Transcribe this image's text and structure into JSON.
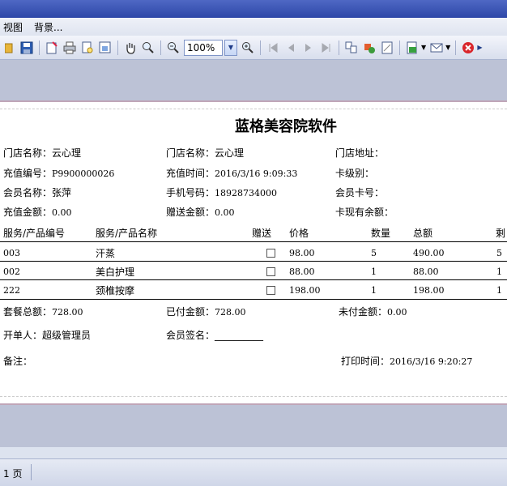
{
  "menu": {
    "view": "视图",
    "background": "背景..."
  },
  "toolbar": {
    "zoom_value": "100%"
  },
  "report": {
    "title": "蓝格美容院软件",
    "fields": {
      "store_name_1": {
        "label": "门店名称：",
        "value": "云心理"
      },
      "store_name_2": {
        "label": "门店名称：",
        "value": "云心理"
      },
      "store_address": {
        "label": "门店地址：",
        "value": ""
      },
      "recharge_no": {
        "label": "充值编号：",
        "value": "P9900000026"
      },
      "recharge_time": {
        "label": "充值时间：",
        "value": "2016/3/16 9:09:33"
      },
      "card_level": {
        "label": "卡级别：",
        "value": ""
      },
      "member_name": {
        "label": "会员名称：",
        "value": "张萍"
      },
      "phone": {
        "label": "手机号码：",
        "value": "18928734000"
      },
      "member_card": {
        "label": "会员卡号：",
        "value": ""
      },
      "recharge_amount": {
        "label": "充值金额：",
        "value": "0.00"
      },
      "gift_amount": {
        "label": "赠送金额：",
        "value": "0.00"
      },
      "card_balance": {
        "label": "卡现有余额：",
        "value": ""
      }
    },
    "table": {
      "headers": {
        "code": "服务/产品编号",
        "name": "服务/产品名称",
        "gift": "赠送",
        "price": "价格",
        "qty": "数量",
        "total": "总额",
        "remain": "剩"
      },
      "rows": [
        {
          "code": "003",
          "name": "汗蒸",
          "gift": false,
          "price": "98.00",
          "qty": "5",
          "total": "490.00",
          "remain": "5"
        },
        {
          "code": "002",
          "name": "美白护理",
          "gift": false,
          "price": "88.00",
          "qty": "1",
          "total": "88.00",
          "remain": "1"
        },
        {
          "code": "222",
          "name": "颈椎按摩",
          "gift": false,
          "price": "198.00",
          "qty": "1",
          "total": "198.00",
          "remain": "1"
        }
      ]
    },
    "summary": {
      "package_total": {
        "label": "套餐总额：",
        "value": "728.00"
      },
      "paid": {
        "label": "已付金额：",
        "value": "728.00"
      },
      "unpaid": {
        "label": "未付金额：",
        "value": "0.00"
      }
    },
    "issuer": {
      "label": "开单人：",
      "value": "超级管理员"
    },
    "signature": {
      "label": "会员签名：",
      "value": "__________"
    },
    "remark": {
      "label": "备注：",
      "value": ""
    },
    "print_time": {
      "label": "打印时间：",
      "value": "2016/3/16 9:20:27"
    }
  },
  "status": {
    "page": "1 页"
  }
}
